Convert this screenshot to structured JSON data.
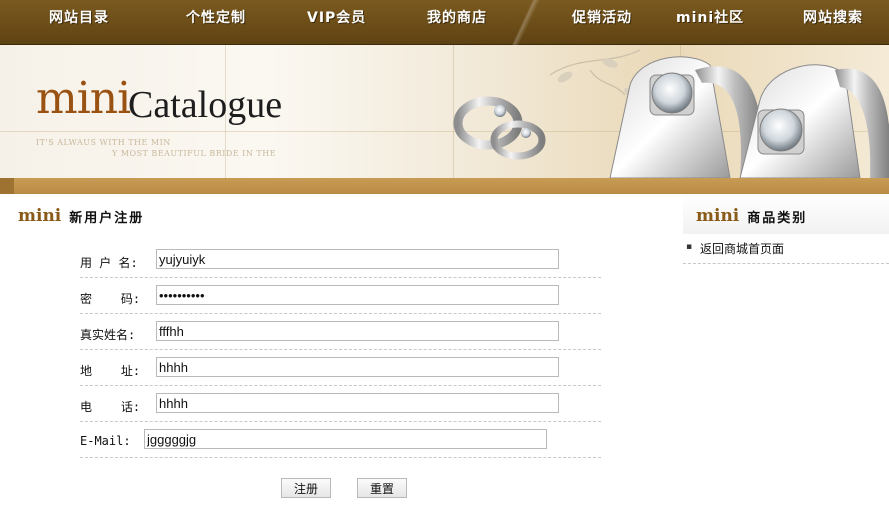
{
  "nav": {
    "items": [
      "网站目录",
      "个性定制",
      "VIP会员",
      "我的商店",
      "促销活动",
      "mini社区",
      "网站搜索"
    ]
  },
  "banner": {
    "logo_mini": "mini",
    "logo_catalogue": "Catalogue",
    "tagline_1": "IT'S ALWAUS WITH THE MIN",
    "tagline_2": "Y MOST BEAUTIFUL BRIDE IN THE"
  },
  "main": {
    "section_mark": "mini",
    "section_title": "新用户注册",
    "fields": [
      {
        "label": "用 户 名:",
        "value": "yujyuiyk",
        "type": "text"
      },
      {
        "label": "密    码:",
        "value": "••••••••••",
        "type": "password"
      },
      {
        "label": "真实姓名:",
        "value": "fffhh",
        "type": "text"
      },
      {
        "label": "地    址:",
        "value": "hhhh",
        "type": "text"
      },
      {
        "label": "电    话:",
        "value": "hhhh",
        "type": "text"
      },
      {
        "label": "E-Mail:",
        "value": "jgggggjg",
        "type": "text"
      }
    ],
    "submit_label": "注册",
    "reset_label": "重置"
  },
  "sidebar": {
    "section_mark": "mini",
    "title": "商品类别",
    "items": [
      {
        "label": "返回商城首页面"
      }
    ]
  },
  "colors": {
    "nav_bg": "#6b4c17",
    "gold_band": "#c29650",
    "logo_brown": "#9a5212"
  }
}
